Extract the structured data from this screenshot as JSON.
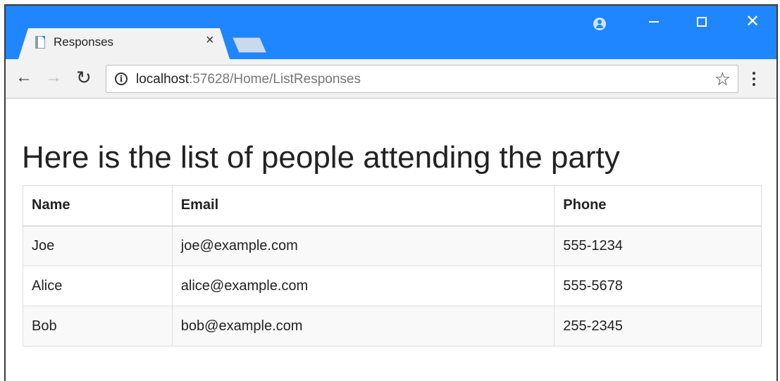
{
  "browser": {
    "tab_title": "Responses",
    "tab_close": "×",
    "url_host": "localhost",
    "url_rest": ":57628/Home/ListResponses",
    "icons": {
      "back": "arrow-left",
      "forward": "arrow-right",
      "reload": "reload",
      "info": "info-circle",
      "star": "star-outline",
      "menu": "vertical-dots",
      "profile": "profile",
      "minimize": "minimize",
      "maximize": "maximize",
      "close": "close"
    },
    "accent_color": "#1f86ff"
  },
  "page": {
    "heading": "Here is the list of people attending the party",
    "table": {
      "headers": [
        "Name",
        "Email",
        "Phone"
      ],
      "rows": [
        [
          "Joe",
          "joe@example.com",
          "555-1234"
        ],
        [
          "Alice",
          "alice@example.com",
          "555-5678"
        ],
        [
          "Bob",
          "bob@example.com",
          "255-2345"
        ]
      ]
    }
  }
}
